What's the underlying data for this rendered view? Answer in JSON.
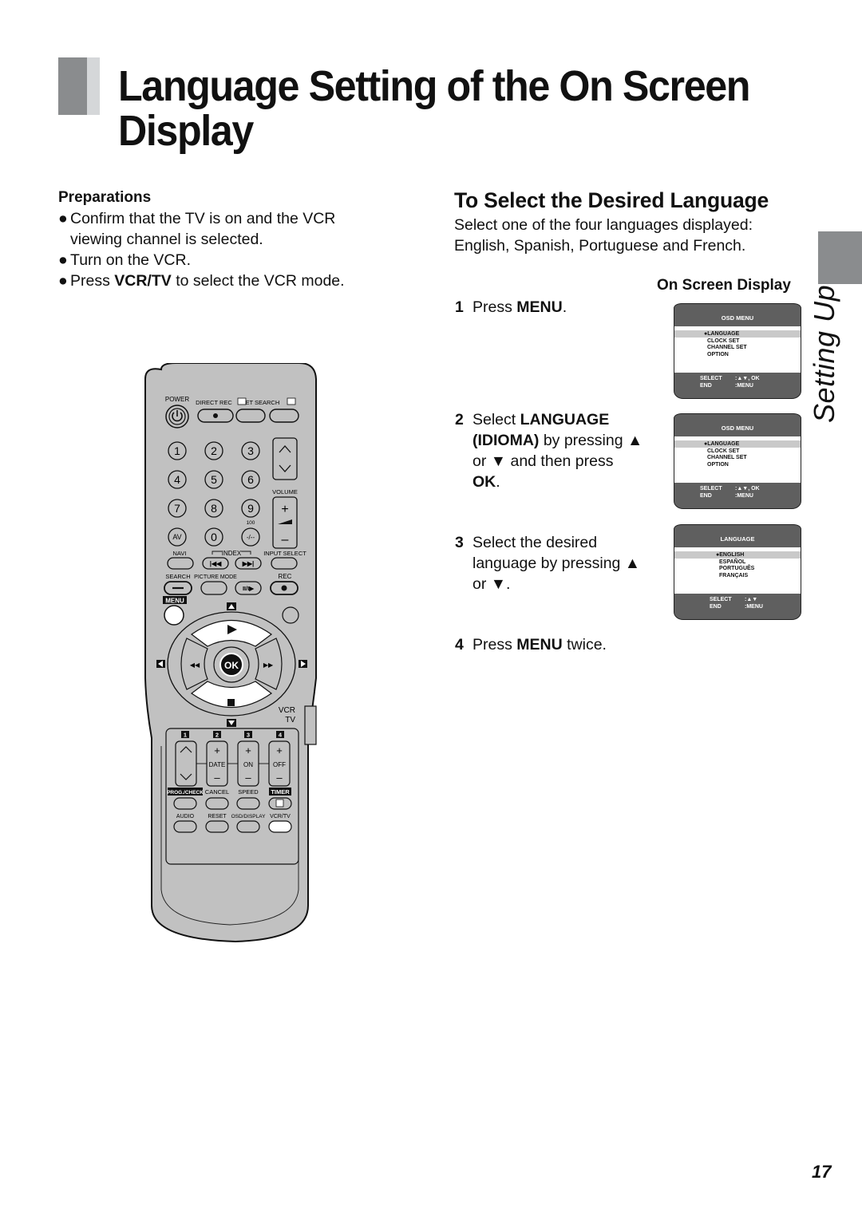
{
  "page": {
    "title": "Language Setting of the On Screen Display",
    "title_line1": "Language Setting of the On Screen",
    "title_line2": "Display",
    "side_tab_label": "Setting Up",
    "page_number": "17"
  },
  "preparations": {
    "heading": "Preparations",
    "bullet_glyph": "●",
    "items": [
      {
        "line1": "Confirm that the TV is on and the VCR",
        "line2": "viewing channel is selected."
      },
      {
        "line1": "Turn on the VCR."
      },
      {
        "pre": "Press ",
        "bold": "VCR/TV",
        "post": " to select the VCR mode."
      }
    ]
  },
  "section": {
    "title": "To Select the Desired Language",
    "desc_line1": "Select one of the four languages displayed:",
    "desc_line2": "English, Spanish, Portuguese and French.",
    "osd_heading": "On Screen Display",
    "steps": [
      {
        "num": "1",
        "pre": "Press ",
        "bold": "MENU",
        "post": "."
      },
      {
        "num": "2",
        "pre": "Select ",
        "bold": "LANGUAGE",
        "line2_bold": "(IDIOMA)",
        "line2": " by pressing ▲",
        "line3": "or ▼ and then press",
        "line4_bold": "OK",
        "line4": "."
      },
      {
        "num": "3",
        "line1": "Select the desired",
        "line2": "language by pressing ▲",
        "line3": "or ▼."
      },
      {
        "num": "4",
        "pre": "Press ",
        "bold": "MENU",
        "post": " twice."
      }
    ]
  },
  "osd_screens": [
    {
      "title": "OSD MENU",
      "items": [
        "●LANGUAGE",
        "CLOCK SET",
        "CHANNEL SET",
        "OPTION"
      ],
      "selected": "LANGUAGE",
      "footer": [
        {
          "key": "SELECT",
          "value": ":▲▼, OK"
        },
        {
          "key": "END",
          "value": ":MENU"
        }
      ]
    },
    {
      "title": "OSD MENU",
      "items": [
        "●LANGUAGE",
        "CLOCK SET",
        "CHANNEL SET",
        "OPTION"
      ],
      "selected": "LANGUAGE",
      "footer": [
        {
          "key": "SELECT",
          "value": ":▲▼, OK"
        },
        {
          "key": "END",
          "value": ":MENU"
        }
      ]
    },
    {
      "title": "LANGUAGE",
      "items": [
        "●ENGLISH",
        "ESPAÑOL",
        "PORTUGUÊS",
        "FRANÇAIS"
      ],
      "selected": "ENGLISH",
      "footer": [
        {
          "key": "SELECT",
          "value": ":▲▼"
        },
        {
          "key": "END",
          "value": ":MENU"
        }
      ]
    }
  ],
  "remote": {
    "labels": {
      "power": "POWER",
      "direct_rec": "DIRECT REC",
      "jet_search": "JET SEARCH",
      "volume": "VOLUME",
      "hundred": "100",
      "navi": "NAVI",
      "index": "INDEX",
      "input_select": "INPUT SELECT",
      "search": "SEARCH",
      "picture_mode": "PICTURE MODE",
      "rec": "REC",
      "menu": "MENU",
      "ok": "OK",
      "vcr": "VCR",
      "tv": "TV",
      "date": "DATE",
      "on": "ON",
      "off": "OFF",
      "prog_check": "PROG./CHECK",
      "cancel": "CANCEL",
      "speed": "SPEED",
      "timer": "TIMER",
      "audio": "AUDIO",
      "reset": "RESET",
      "osd_display": "OSD/DISPLAY",
      "vcr_tv": "VCR/TV"
    },
    "number_keys": [
      "1",
      "2",
      "3",
      "4",
      "5",
      "6",
      "7",
      "8",
      "9",
      "AV",
      "0",
      "-/--"
    ],
    "slot_numbers": [
      "1",
      "2",
      "3",
      "4"
    ],
    "vol_plus": "+",
    "vol_minus": "–"
  }
}
